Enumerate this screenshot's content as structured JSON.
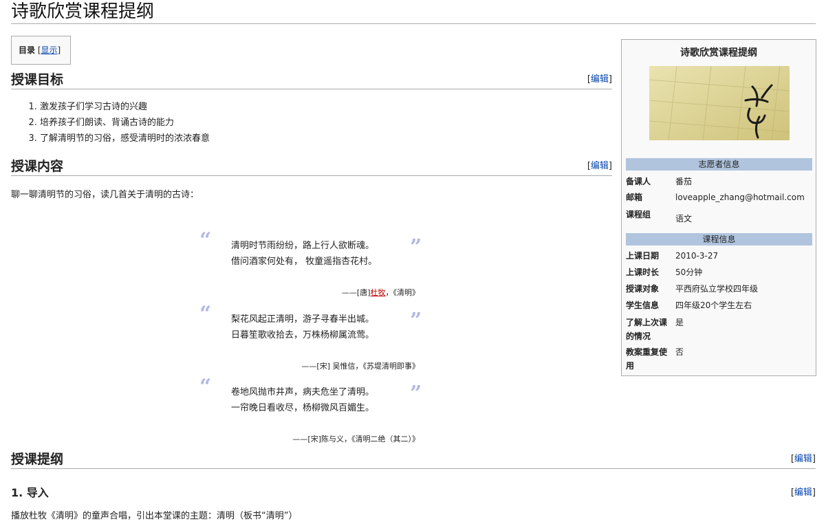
{
  "page": {
    "title": "诗歌欣赏课程提纲"
  },
  "toc": {
    "label": "目录",
    "bracket_open": "[",
    "toggle": "显示",
    "bracket_close": "]"
  },
  "edit": {
    "open": "[",
    "label": "编辑",
    "close": "]"
  },
  "sections": {
    "goals": {
      "heading": "授课目标",
      "items": [
        "激发孩子们学习古诗的兴趣",
        "培养孩子们朗读、背诵古诗的能力",
        "了解清明节的习俗，感受清明时的浓浓春意"
      ]
    },
    "content": {
      "heading": "授课内容",
      "intro": "聊一聊清明节的习俗，读几首关于清明的古诗：",
      "poems": [
        {
          "line1": "清明时节雨纷纷，路上行人欲断魂。",
          "line2": "借问酒家何处有， 牧童遥指杏花村。",
          "src_prefix": "——[唐]",
          "src_author": "杜牧",
          "src_suffix": "，《清明》"
        },
        {
          "line1": "梨花风起正清明，游子寻春半出城。",
          "line2": "日暮笙歌收拾去，万株杨柳属流莺。",
          "src_prefix": "——[宋] 吴惟信，《苏堤清明即事》",
          "src_author": "",
          "src_suffix": ""
        },
        {
          "line1": "卷地风抛市井声，病夫危坐了清明。",
          "line2": "一帘晚日看收尽，杨柳微风百媚生。",
          "src_prefix": "——[宋]陈与义，《清明二绝（其二）》",
          "src_author": "",
          "src_suffix": ""
        }
      ]
    },
    "outline": {
      "heading": "授课提纲"
    },
    "intro": {
      "heading": "1. 导入",
      "text": "播放杜牧《清明》的童声合唱，引出本堂课的主题：清明（板书“清明”）"
    }
  },
  "infobox": {
    "title": "诗歌欣赏课程提纲",
    "volunteer_header": "志愿者信息",
    "volunteer_rows": [
      {
        "k": "备课人",
        "v": "番茄"
      },
      {
        "k": "邮箱",
        "v": "loveapple_zhang@hotmail.com"
      },
      {
        "k": "课程组",
        "v": "语文"
      }
    ],
    "course_header": "课程信息",
    "course_rows": [
      {
        "k": "上课日期",
        "v": "2010-3-27"
      },
      {
        "k": "上课时长",
        "v": "50分钟"
      },
      {
        "k": "授课对象",
        "v": "平西府弘立学校四年级"
      },
      {
        "k": "学生信息",
        "v": "四年级20个学生左右"
      },
      {
        "k": "了解上次课的情况",
        "v": "是"
      },
      {
        "k": "教案重复使用",
        "v": "否"
      }
    ]
  },
  "colors": {
    "link": "#0645ad",
    "quote_mark": "#b3b7e6",
    "infobox_header": "#b0c4de"
  }
}
